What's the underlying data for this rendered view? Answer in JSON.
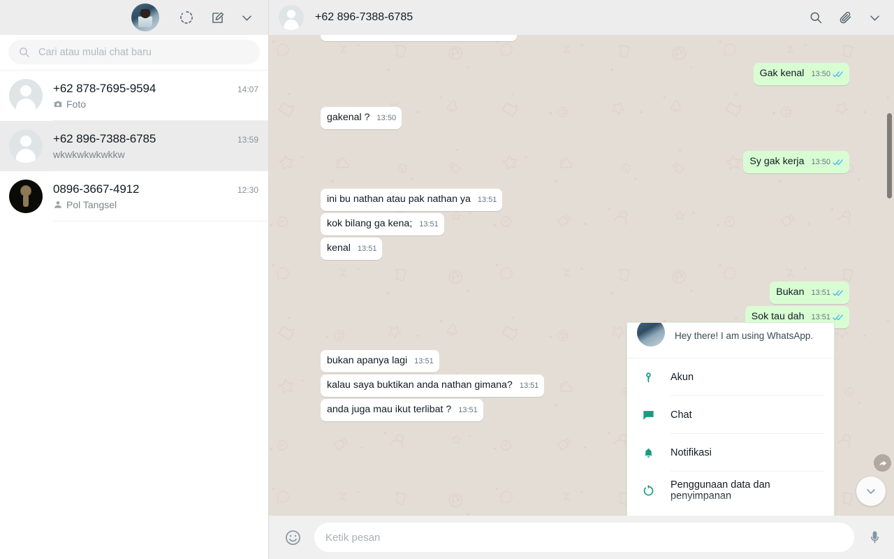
{
  "sidebar": {
    "header": {
      "avatar_name": "my-profile-avatar",
      "status_label": "Status",
      "new_chat_label": "Chat baru",
      "menu_label": "Menu"
    },
    "search": {
      "placeholder": "Cari atau mulai chat baru",
      "value": ""
    },
    "chats": [
      {
        "name": "+62 878-7695-9594",
        "preview": "Foto",
        "time": "14:07",
        "icon": "camera-icon",
        "avatar": "placeholder",
        "active": false
      },
      {
        "name": "+62 896-7388-6785",
        "preview": "wkwkwkwkwkkw",
        "time": "13:59",
        "icon": "none",
        "avatar": "placeholder",
        "active": true
      },
      {
        "name": "0896-3667-4912",
        "preview": "Pol Tangsel",
        "time": "12:30",
        "icon": "contact-icon",
        "avatar": "groot",
        "active": false
      }
    ]
  },
  "chat_header": {
    "title": "+62 896-7388-6785",
    "search_label": "Cari",
    "attach_label": "Lampirkan",
    "menu_label": "Menu"
  },
  "messages": [
    {
      "kind": "clipped",
      "dir": "in"
    },
    {
      "kind": "gap_lg"
    },
    {
      "kind": "msg",
      "dir": "out",
      "text": "Gak kenal",
      "time": "13:50",
      "status": "read"
    },
    {
      "kind": "gap_lg"
    },
    {
      "kind": "msg",
      "dir": "in",
      "text": "gakenal ?",
      "time": "13:50"
    },
    {
      "kind": "gap_lg"
    },
    {
      "kind": "msg",
      "dir": "out",
      "text": "Sy gak kerja",
      "time": "13:50",
      "status": "read"
    },
    {
      "kind": "gap"
    },
    {
      "kind": "msg",
      "dir": "in",
      "text": "ini bu nathan atau pak nathan ya",
      "time": "13:51"
    },
    {
      "kind": "msg",
      "dir": "in",
      "text": "kok bilang ga kena;",
      "time": "13:51"
    },
    {
      "kind": "msg",
      "dir": "in",
      "text": "kenal",
      "time": "13:51"
    },
    {
      "kind": "gap_lg"
    },
    {
      "kind": "msg",
      "dir": "out",
      "text": "Bukan",
      "time": "13:51",
      "status": "read"
    },
    {
      "kind": "msg",
      "dir": "out",
      "text": "Sok tau dah",
      "time": "13:51",
      "status": "read"
    },
    {
      "kind": "gap_lg"
    },
    {
      "kind": "msg",
      "dir": "in",
      "text": "bukan apanya lagi",
      "time": "13:51"
    },
    {
      "kind": "msg",
      "dir": "in",
      "text": "kalau saya buktikan anda nathan gimana?",
      "time": "13:51"
    },
    {
      "kind": "msg",
      "dir": "in",
      "text": "anda juga mau ikut terlibat ?",
      "time": "13:51"
    }
  ],
  "settings_panel": {
    "profile_status": "Hey there! I am using WhatsApp.",
    "items": [
      {
        "label": "Akun",
        "icon": "key-icon"
      },
      {
        "label": "Chat",
        "icon": "chat-icon"
      },
      {
        "label": "Notifikasi",
        "icon": "bell-icon"
      },
      {
        "label": "Penggunaan data dan penyimpanan",
        "icon": "data-usage-icon"
      }
    ]
  },
  "composer": {
    "emoji_label": "Emoji",
    "placeholder": "Ketik pesan",
    "value": "",
    "mic_label": "Rekam pesan suara"
  },
  "controls": {
    "forward_label": "Teruskan",
    "scroll_down_label": "Gulir ke bawah"
  },
  "colors": {
    "outgoing_bubble": "#d9fdd3",
    "incoming_bubble": "#ffffff",
    "tick_read": "#53bdeb",
    "accent": "#159d82",
    "chat_bg": "#e4ddd6",
    "header_bg": "#ededed"
  }
}
